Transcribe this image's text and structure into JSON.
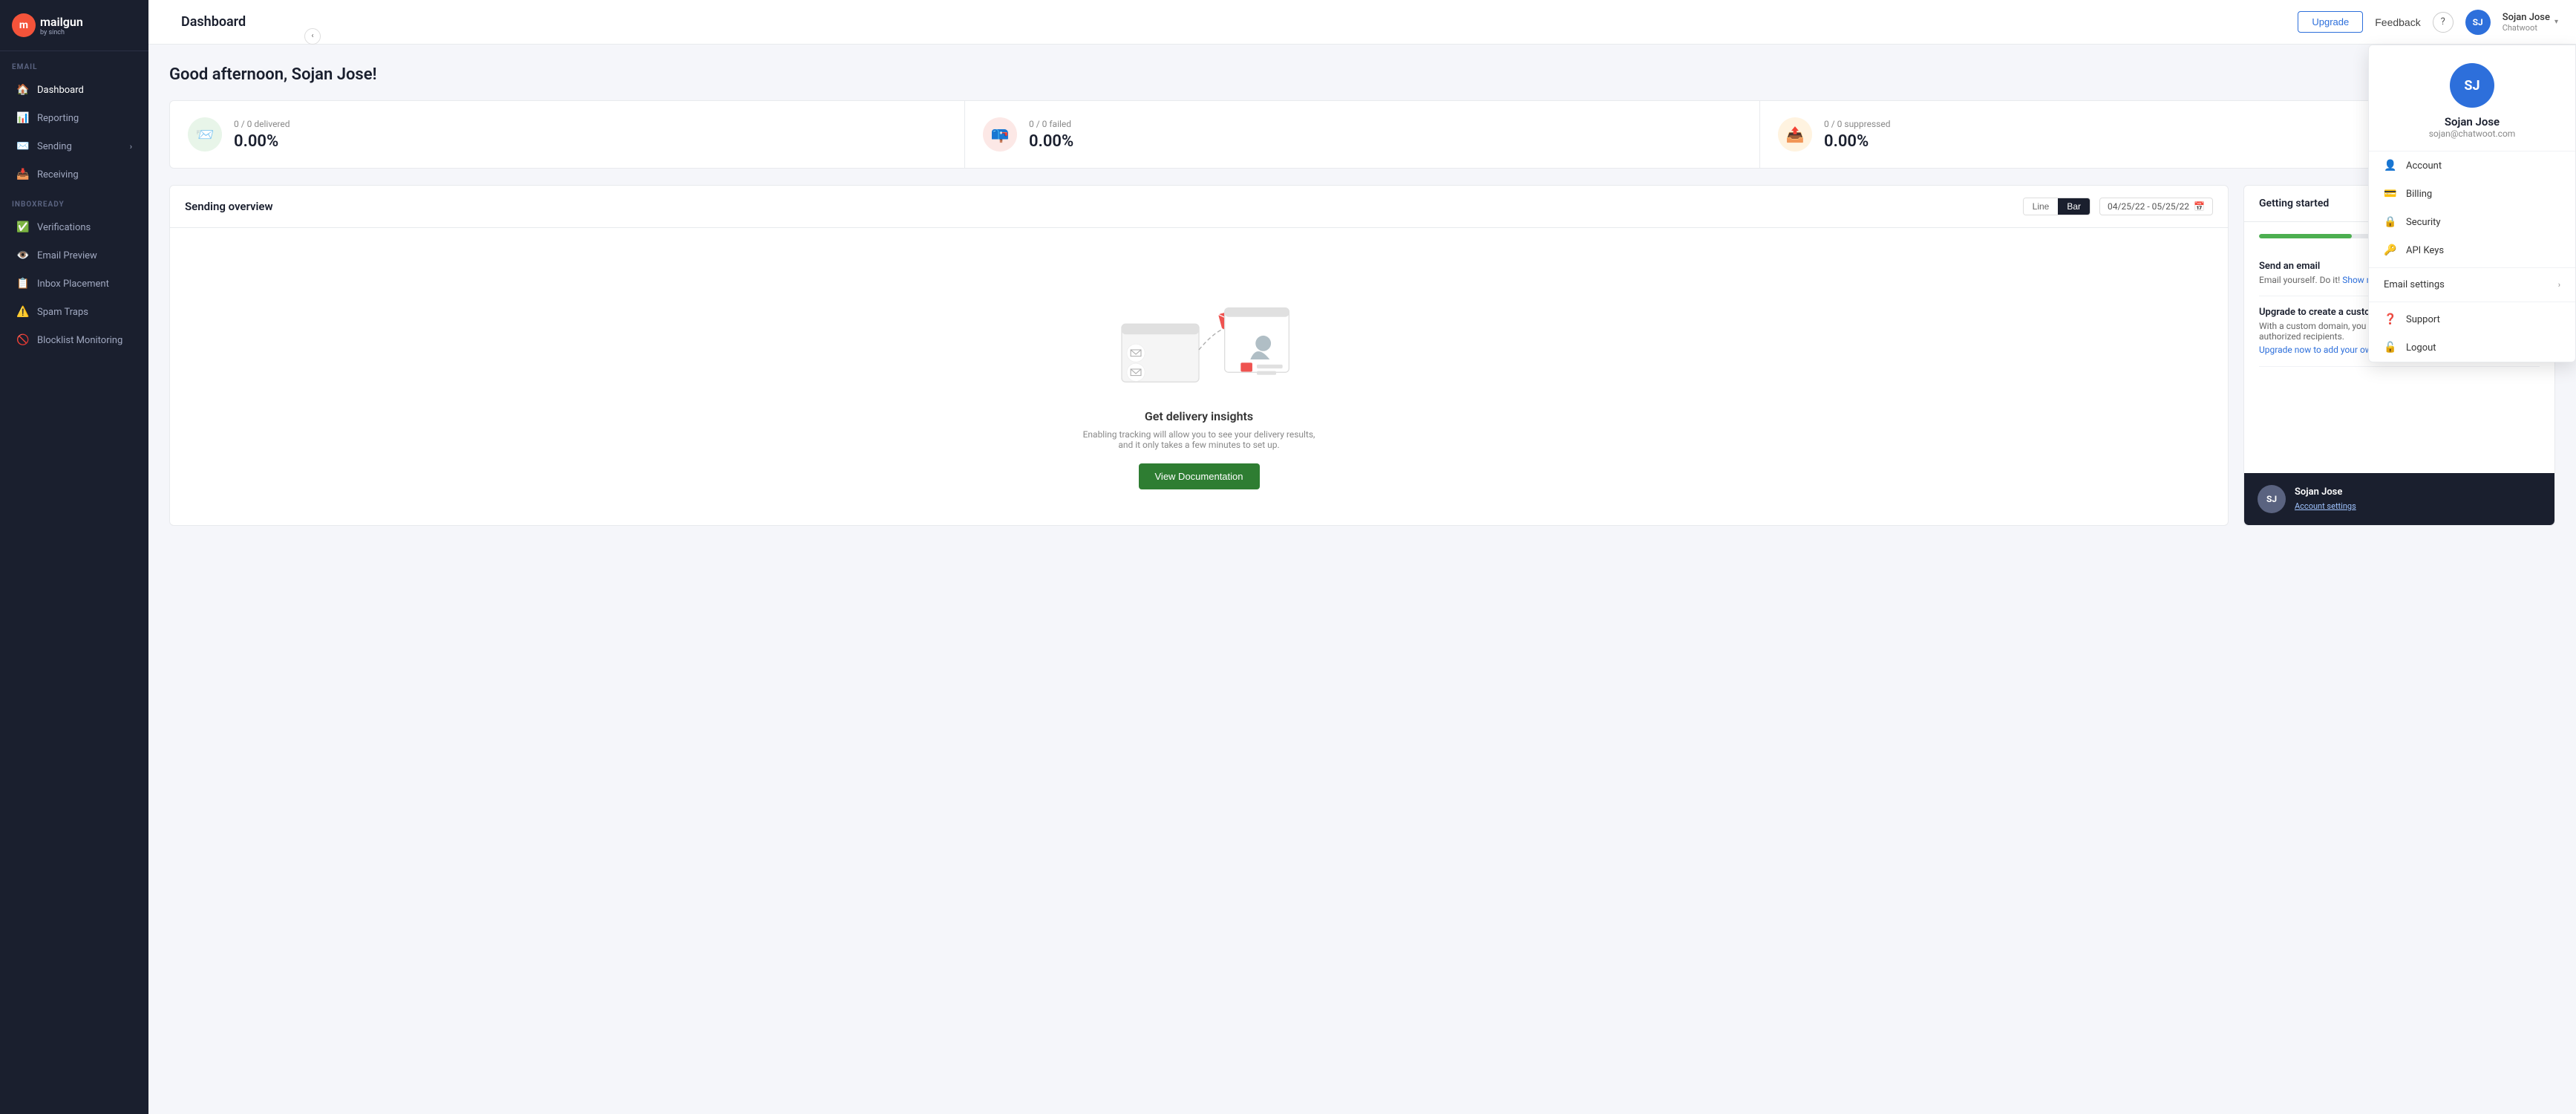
{
  "brand": {
    "logo_initials": "m",
    "logo_name": "mailgun",
    "logo_sub": "by sinch"
  },
  "sidebar": {
    "email_section_label": "EMAIL",
    "inboxready_section_label": "INBOXREADY",
    "items": [
      {
        "id": "dashboard",
        "label": "Dashboard",
        "icon": "🏠",
        "active": true
      },
      {
        "id": "reporting",
        "label": "Reporting",
        "icon": "📊",
        "active": false
      },
      {
        "id": "sending",
        "label": "Sending",
        "icon": "✉️",
        "has_chevron": true,
        "active": false
      },
      {
        "id": "receiving",
        "label": "Receiving",
        "icon": "📥",
        "active": false
      }
    ],
    "inboxready_items": [
      {
        "id": "verifications",
        "label": "Verifications",
        "icon": "✅",
        "active": false
      },
      {
        "id": "email-preview",
        "label": "Email Preview",
        "icon": "👁️",
        "active": false
      },
      {
        "id": "inbox-placement",
        "label": "Inbox Placement",
        "icon": "📋",
        "active": false
      },
      {
        "id": "spam-traps",
        "label": "Spam Traps",
        "icon": "⚠️",
        "active": false
      },
      {
        "id": "blocklist-monitoring",
        "label": "Blocklist Monitoring",
        "icon": "🚫",
        "active": false
      }
    ]
  },
  "topbar": {
    "title": "Dashboard",
    "upgrade_label": "Upgrade",
    "feedback_label": "Feedback",
    "help_icon": "?",
    "user_initials": "SJ",
    "user_name": "Sojan Jose",
    "user_org": "Chatwoot"
  },
  "main": {
    "greeting": "Good afternoon, Sojan Jose!",
    "stats": [
      {
        "label": "0 / 0 delivered",
        "value": "0.00%",
        "icon": "📨",
        "color": "green"
      },
      {
        "label": "0 / 0 failed",
        "value": "0.00%",
        "icon": "📪",
        "color": "red"
      },
      {
        "label": "0 / 0 suppressed",
        "value": "0.00%",
        "icon": "📤",
        "color": "orange"
      }
    ],
    "sending_overview": {
      "title": "Sending overview",
      "chart_toggle_line": "Line",
      "chart_toggle_bar": "Bar",
      "date_range": "04/25/22 - 05/25/22",
      "empty_title": "Get delivery insights",
      "empty_desc": "Enabling tracking will allow you to see your delivery results, and it only takes a few minutes to set up.",
      "view_docs_label": "View Documentation"
    },
    "getting_started": {
      "title": "Getting started",
      "progress_pct": 33,
      "tasks": [
        {
          "title": "Send an email",
          "desc": "Email yourself. Do it!",
          "link_text": "Show me how.",
          "link_url": "#"
        },
        {
          "title": "Upgrade to create a custom domain",
          "desc": "With a custom domain, you can send to all your contacts, not just authorized recipients.",
          "link_text": "Upgrade now to add your own custom domains.",
          "link_url": "#"
        }
      ],
      "user_panel": {
        "initials": "SJ",
        "name": "Sojan Jose",
        "settings_label": "Account settings"
      }
    }
  },
  "dropdown": {
    "visible": true,
    "avatar_initials": "SJ",
    "name": "Sojan Jose",
    "email": "sojan@chatwoot.com",
    "menu_items": [
      {
        "id": "account",
        "label": "Account",
        "icon": "👤"
      },
      {
        "id": "billing",
        "label": "Billing",
        "icon": "💳"
      },
      {
        "id": "security",
        "label": "Security",
        "icon": "🔒"
      },
      {
        "id": "api-keys",
        "label": "API Keys",
        "icon": "🔑"
      }
    ],
    "email_settings_label": "Email settings",
    "support_label": "Support",
    "support_icon": "❓",
    "logout_label": "Logout",
    "logout_icon": "🔓"
  }
}
